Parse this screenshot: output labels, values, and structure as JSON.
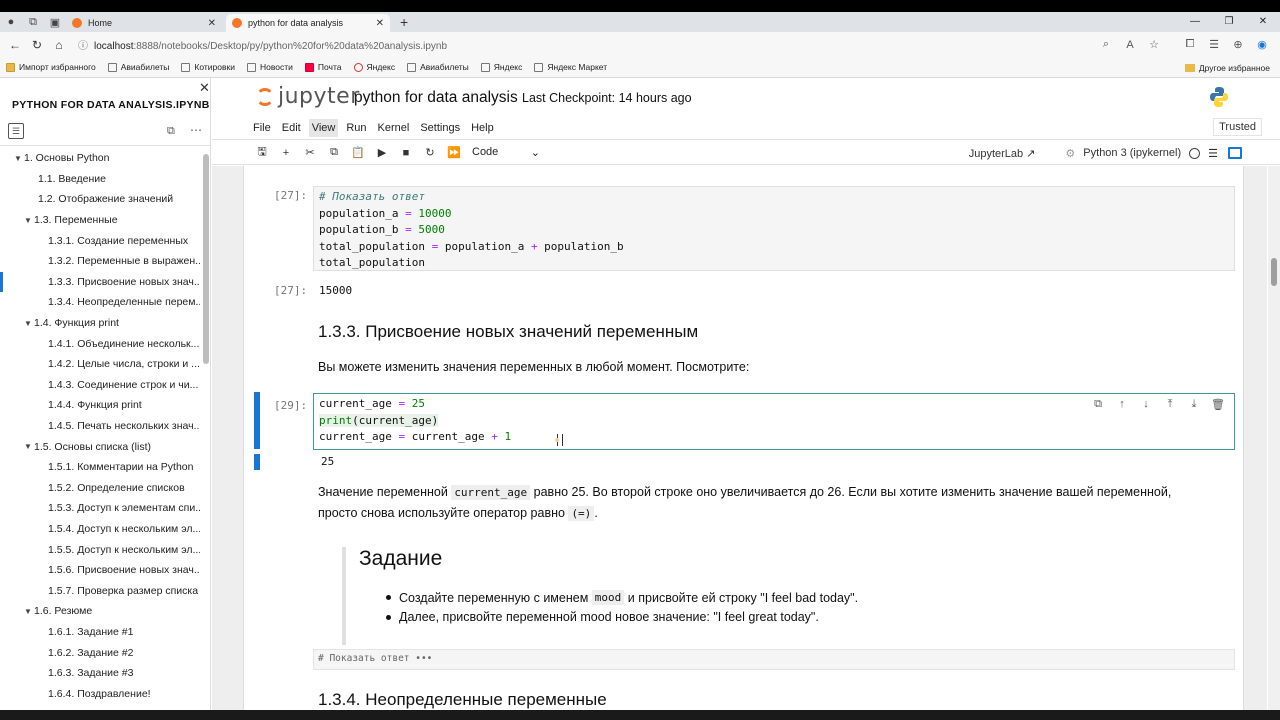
{
  "browser": {
    "tabs": [
      {
        "title": "Home",
        "favicon_color": "#f37726"
      },
      {
        "title": "python for data analysis",
        "favicon_color": "#f37726"
      }
    ],
    "url": {
      "host": "localhost",
      "path": ":8888/notebooks/Desktop/py/python%20for%20data%20analysis.ipynb"
    },
    "bookmarks": [
      "Импорт избранного",
      "Авиабилеты",
      "Котировки",
      "Новости",
      "Почта",
      "Яндекс",
      "Авиабилеты",
      "Яндекс",
      "Яндекс Маркет"
    ],
    "bookmarks_right": "Другое избранное"
  },
  "sidebar": {
    "title": "PYTHON FOR DATA ANALYSIS.IPYNB",
    "toc": [
      {
        "label": "1. Основы Python",
        "level": "l1",
        "caret": true
      },
      {
        "label": "1.1. Введение",
        "level": "l2"
      },
      {
        "label": "1.2. Отображение значений",
        "level": "l2"
      },
      {
        "label": "1.3. Переменные",
        "level": "l2c",
        "caret": true
      },
      {
        "label": "1.3.1. Создание переменных",
        "level": "l3"
      },
      {
        "label": "1.3.2. Переменные в выражен...",
        "level": "l3"
      },
      {
        "label": "1.3.3. Присвоение новых знач...",
        "level": "l3",
        "selected": true
      },
      {
        "label": "1.3.4. Неопределенные перем...",
        "level": "l3"
      },
      {
        "label": "1.4. Функция print",
        "level": "l2c",
        "caret": true
      },
      {
        "label": "1.4.1. Объединение нескольк...",
        "level": "l3"
      },
      {
        "label": "1.4.2. Целые числа, строки и ...",
        "level": "l3"
      },
      {
        "label": "1.4.3. Соединение строк и чи...",
        "level": "l3"
      },
      {
        "label": "1.4.4. Функция print",
        "level": "l3"
      },
      {
        "label": "1.4.5. Печать нескольких знач...",
        "level": "l3"
      },
      {
        "label": "1.5. Основы списка (list)",
        "level": "l2c",
        "caret": true
      },
      {
        "label": "1.5.1. Комментарии на Python",
        "level": "l3"
      },
      {
        "label": "1.5.2. Определение списков",
        "level": "l3"
      },
      {
        "label": "1.5.3. Доступ к элементам спи...",
        "level": "l3"
      },
      {
        "label": "1.5.4. Доступ к нескольким эл...",
        "level": "l3"
      },
      {
        "label": "1.5.5. Доступ к нескольким эл...",
        "level": "l3"
      },
      {
        "label": "1.5.6. Присвоение новых знач...",
        "level": "l3"
      },
      {
        "label": "1.5.7. Проверка размер списка",
        "level": "l3"
      },
      {
        "label": "1.6. Резюме",
        "level": "l2c",
        "caret": true
      },
      {
        "label": "1.6.1. Задание #1",
        "level": "l3"
      },
      {
        "label": "1.6.2. Задание #2",
        "level": "l3"
      },
      {
        "label": "1.6.3. Задание #3",
        "level": "l3"
      },
      {
        "label": "1.6.4. Поздравление!",
        "level": "l3"
      }
    ]
  },
  "jupyter": {
    "logo_text": "jupyter",
    "notebook_title": "python for data analysis",
    "checkpoint": "Last Checkpoint: 14 hours ago",
    "menu": [
      "File",
      "Edit",
      "View",
      "Run",
      "Kernel",
      "Settings",
      "Help"
    ],
    "trusted": "Trusted",
    "cell_type": "Code",
    "jupyterlab_link": "JupyterLab",
    "kernel": "Python 3 (ipykernel)"
  },
  "cells": {
    "c27_prompt": "[27]:",
    "c27_out_prompt": "[27]:",
    "c27_output": "15000",
    "heading": "1.3.3. Присвоение новых значений переменным",
    "intro": "Вы можете изменить значения переменных в любой момент. Посмотрите:",
    "c29_prompt": "[29]:",
    "c29_output": "25",
    "explain_1": "Значение переменной",
    "explain_code": "current_age",
    "explain_2": "равно 25. Во второй строке оно увеличивается до 26. Если вы хотите изменить значение вашей переменной,",
    "explain_3": "просто снова используйте оператор равно",
    "explain_code2": "(=)",
    "explain_4": ".",
    "task_title": "Задание",
    "task_b1_a": "Создайте переменную с именем",
    "task_b1_code": "mood",
    "task_b1_b": "и присвойте ей строку \"I feel bad today\".",
    "task_b2": "Далее, присвойте переменной mood новое значение: \"I feel great today\".",
    "collapsed_code": "# Показать ответ •••",
    "next_heading": "1.3.4. Неопределенные переменные"
  }
}
